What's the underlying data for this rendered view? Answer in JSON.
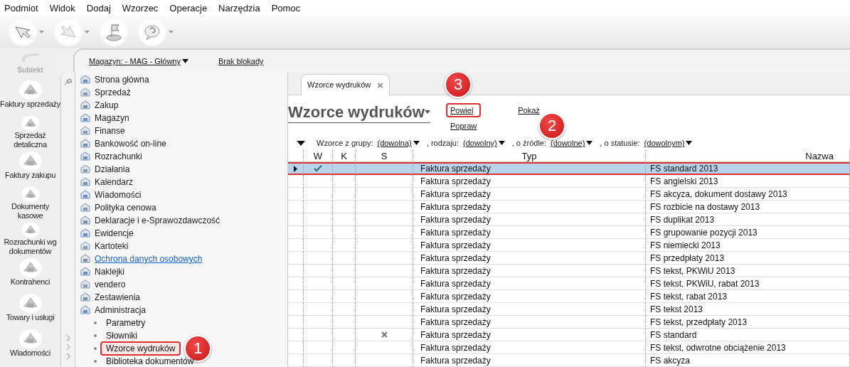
{
  "menu": [
    "Podmiot",
    "Widok",
    "Dodaj",
    "Wzorzec",
    "Operacje",
    "Narzędzia",
    "Pomoc"
  ],
  "toolbar": [
    {
      "kind": "back",
      "dropdown": true
    },
    {
      "kind": "forward",
      "dropdown": true
    },
    {
      "kind": "flag",
      "dropdown": false
    },
    {
      "kind": "help",
      "dropdown": true
    }
  ],
  "logo": {
    "text": "Subiekt"
  },
  "nav": [
    {
      "label": "Faktury sprzedaży"
    },
    {
      "label": "Sprzedaż detaliczna"
    },
    {
      "label": "Faktury zakupu"
    },
    {
      "label": "Dokumenty kasowe"
    },
    {
      "label": "Rozrachunki wg dokumentów"
    },
    {
      "label": "Kontrahenci"
    },
    {
      "label": "Towary i usługi"
    },
    {
      "label": "Wiadomości"
    }
  ],
  "topbar": {
    "warehouse": "Magazyn: - MAG - Główny",
    "lock": "Brak blokady"
  },
  "tree": [
    {
      "label": "Strona główna",
      "kind": "item"
    },
    {
      "label": "Sprzedaż",
      "kind": "item"
    },
    {
      "label": "Zakup",
      "kind": "item"
    },
    {
      "label": "Magazyn",
      "kind": "item"
    },
    {
      "label": "Finanse",
      "kind": "item"
    },
    {
      "label": "Bankowość on-line",
      "kind": "item"
    },
    {
      "label": "Rozrachunki",
      "kind": "item"
    },
    {
      "label": "Działania",
      "kind": "item"
    },
    {
      "label": "Kalendarz",
      "kind": "item"
    },
    {
      "label": "Wiadomości",
      "kind": "item"
    },
    {
      "label": "Polityka cenowa",
      "kind": "item"
    },
    {
      "label": "Deklaracje i e-Sprawozdawczość",
      "kind": "item"
    },
    {
      "label": "Ewidencje",
      "kind": "item"
    },
    {
      "label": "Kartoteki",
      "kind": "item"
    },
    {
      "label": "Ochrona danych osobowych",
      "kind": "link"
    },
    {
      "label": "Naklejki",
      "kind": "item"
    },
    {
      "label": "vendero",
      "kind": "item"
    },
    {
      "label": "Zestawienia",
      "kind": "item"
    },
    {
      "label": "Administracja",
      "kind": "item",
      "children": [
        {
          "label": "Parametry",
          "selected": false
        },
        {
          "label": "Słowniki",
          "selected": false
        },
        {
          "label": "Wzorce wydruków",
          "selected": true,
          "badge": "1"
        },
        {
          "label": "Biblioteka dokumentów",
          "selected": false
        }
      ]
    }
  ],
  "tabs": [
    {
      "label": "Wzorce wydruków",
      "selected": true,
      "close": "×"
    }
  ],
  "page": {
    "title": "Wzorce wydruków",
    "actions": [
      {
        "label": "Powiel",
        "badge": "3"
      },
      {
        "label": "Popraw"
      },
      {
        "label": "Pokaż"
      }
    ]
  },
  "filters": [
    {
      "label": "Wzorce z grupy:",
      "value": "(dowolna)"
    },
    {
      "label": ", rodzaju:",
      "value": "(dowolny)"
    },
    {
      "label": ", o źródle:",
      "value": "(dowolne)",
      "badge": "2"
    },
    {
      "label": ", o statusie:",
      "value": "(dowolnym)"
    }
  ],
  "table": {
    "columns": [
      "W",
      "K",
      "S",
      "Typ",
      "Nazwa"
    ],
    "rows": [
      {
        "selected": true,
        "w": true,
        "s": false,
        "typ": "Faktura sprzedaży",
        "nazwa": "FS standard 2013"
      },
      {
        "selected": false,
        "w": false,
        "s": false,
        "typ": "Faktura sprzedaży",
        "nazwa": "FS angielski 2013"
      },
      {
        "selected": false,
        "w": false,
        "s": false,
        "typ": "Faktura sprzedaży",
        "nazwa": "FS akcyza, dokument dostawy 2013"
      },
      {
        "selected": false,
        "w": false,
        "s": false,
        "typ": "Faktura sprzedaży",
        "nazwa": "FS rozbicie na dostawy 2013"
      },
      {
        "selected": false,
        "w": false,
        "s": false,
        "typ": "Faktura sprzedaży",
        "nazwa": "FS duplikat 2013"
      },
      {
        "selected": false,
        "w": false,
        "s": false,
        "typ": "Faktura sprzedaży",
        "nazwa": "FS grupowanie pozycji 2013"
      },
      {
        "selected": false,
        "w": false,
        "s": false,
        "typ": "Faktura sprzedaży",
        "nazwa": "FS niemiecki 2013"
      },
      {
        "selected": false,
        "w": false,
        "s": false,
        "typ": "Faktura sprzedaży",
        "nazwa": "FS przedpłaty 2013"
      },
      {
        "selected": false,
        "w": false,
        "s": false,
        "typ": "Faktura sprzedaży",
        "nazwa": "FS tekst, PKWiU 2013"
      },
      {
        "selected": false,
        "w": false,
        "s": false,
        "typ": "Faktura sprzedaży",
        "nazwa": "FS tekst, PKWiU, rabat 2013"
      },
      {
        "selected": false,
        "w": false,
        "s": false,
        "typ": "Faktura sprzedaży",
        "nazwa": "FS tekst, rabat 2013"
      },
      {
        "selected": false,
        "w": false,
        "s": false,
        "typ": "Faktura sprzedaży",
        "nazwa": "FS tekst 2013"
      },
      {
        "selected": false,
        "w": false,
        "s": false,
        "typ": "Faktura sprzedaży",
        "nazwa": "FS tekst, przedpłaty 2013"
      },
      {
        "selected": false,
        "w": false,
        "s": true,
        "typ": "Faktura sprzedaży",
        "nazwa": "FS standard"
      },
      {
        "selected": false,
        "w": false,
        "s": false,
        "typ": "Faktura sprzedaży",
        "nazwa": "FS tekst, odwrotne obciążenie 2013"
      },
      {
        "selected": false,
        "w": false,
        "s": false,
        "typ": "Faktura sprzedaży",
        "nazwa": "FS akcyza"
      }
    ]
  }
}
